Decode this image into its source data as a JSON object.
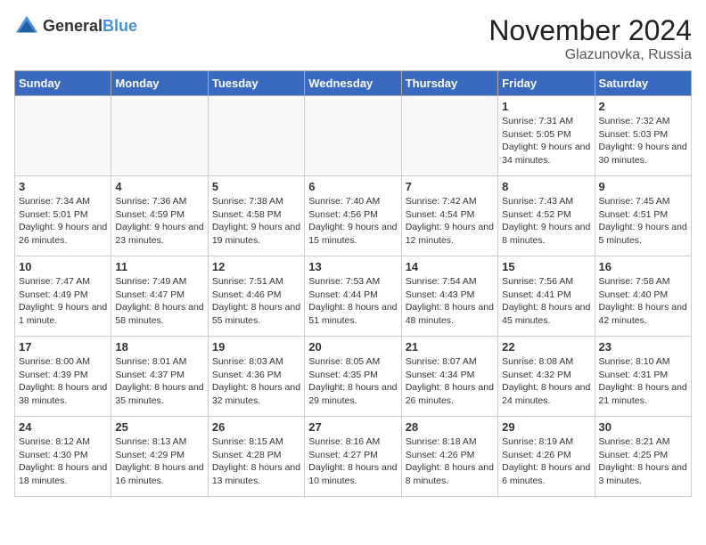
{
  "header": {
    "logo_general": "General",
    "logo_blue": "Blue",
    "month": "November 2024",
    "location": "Glazunovka, Russia"
  },
  "weekdays": [
    "Sunday",
    "Monday",
    "Tuesday",
    "Wednesday",
    "Thursday",
    "Friday",
    "Saturday"
  ],
  "weeks": [
    [
      {
        "day": "",
        "info": ""
      },
      {
        "day": "",
        "info": ""
      },
      {
        "day": "",
        "info": ""
      },
      {
        "day": "",
        "info": ""
      },
      {
        "day": "",
        "info": ""
      },
      {
        "day": "1",
        "info": "Sunrise: 7:31 AM\nSunset: 5:05 PM\nDaylight: 9 hours\nand 34 minutes."
      },
      {
        "day": "2",
        "info": "Sunrise: 7:32 AM\nSunset: 5:03 PM\nDaylight: 9 hours\nand 30 minutes."
      }
    ],
    [
      {
        "day": "3",
        "info": "Sunrise: 7:34 AM\nSunset: 5:01 PM\nDaylight: 9 hours\nand 26 minutes."
      },
      {
        "day": "4",
        "info": "Sunrise: 7:36 AM\nSunset: 4:59 PM\nDaylight: 9 hours\nand 23 minutes."
      },
      {
        "day": "5",
        "info": "Sunrise: 7:38 AM\nSunset: 4:58 PM\nDaylight: 9 hours\nand 19 minutes."
      },
      {
        "day": "6",
        "info": "Sunrise: 7:40 AM\nSunset: 4:56 PM\nDaylight: 9 hours\nand 15 minutes."
      },
      {
        "day": "7",
        "info": "Sunrise: 7:42 AM\nSunset: 4:54 PM\nDaylight: 9 hours\nand 12 minutes."
      },
      {
        "day": "8",
        "info": "Sunrise: 7:43 AM\nSunset: 4:52 PM\nDaylight: 9 hours\nand 8 minutes."
      },
      {
        "day": "9",
        "info": "Sunrise: 7:45 AM\nSunset: 4:51 PM\nDaylight: 9 hours\nand 5 minutes."
      }
    ],
    [
      {
        "day": "10",
        "info": "Sunrise: 7:47 AM\nSunset: 4:49 PM\nDaylight: 9 hours\nand 1 minute."
      },
      {
        "day": "11",
        "info": "Sunrise: 7:49 AM\nSunset: 4:47 PM\nDaylight: 8 hours\nand 58 minutes."
      },
      {
        "day": "12",
        "info": "Sunrise: 7:51 AM\nSunset: 4:46 PM\nDaylight: 8 hours\nand 55 minutes."
      },
      {
        "day": "13",
        "info": "Sunrise: 7:53 AM\nSunset: 4:44 PM\nDaylight: 8 hours\nand 51 minutes."
      },
      {
        "day": "14",
        "info": "Sunrise: 7:54 AM\nSunset: 4:43 PM\nDaylight: 8 hours\nand 48 minutes."
      },
      {
        "day": "15",
        "info": "Sunrise: 7:56 AM\nSunset: 4:41 PM\nDaylight: 8 hours\nand 45 minutes."
      },
      {
        "day": "16",
        "info": "Sunrise: 7:58 AM\nSunset: 4:40 PM\nDaylight: 8 hours\nand 42 minutes."
      }
    ],
    [
      {
        "day": "17",
        "info": "Sunrise: 8:00 AM\nSunset: 4:39 PM\nDaylight: 8 hours\nand 38 minutes."
      },
      {
        "day": "18",
        "info": "Sunrise: 8:01 AM\nSunset: 4:37 PM\nDaylight: 8 hours\nand 35 minutes."
      },
      {
        "day": "19",
        "info": "Sunrise: 8:03 AM\nSunset: 4:36 PM\nDaylight: 8 hours\nand 32 minutes."
      },
      {
        "day": "20",
        "info": "Sunrise: 8:05 AM\nSunset: 4:35 PM\nDaylight: 8 hours\nand 29 minutes."
      },
      {
        "day": "21",
        "info": "Sunrise: 8:07 AM\nSunset: 4:34 PM\nDaylight: 8 hours\nand 26 minutes."
      },
      {
        "day": "22",
        "info": "Sunrise: 8:08 AM\nSunset: 4:32 PM\nDaylight: 8 hours\nand 24 minutes."
      },
      {
        "day": "23",
        "info": "Sunrise: 8:10 AM\nSunset: 4:31 PM\nDaylight: 8 hours\nand 21 minutes."
      }
    ],
    [
      {
        "day": "24",
        "info": "Sunrise: 8:12 AM\nSunset: 4:30 PM\nDaylight: 8 hours\nand 18 minutes."
      },
      {
        "day": "25",
        "info": "Sunrise: 8:13 AM\nSunset: 4:29 PM\nDaylight: 8 hours\nand 16 minutes."
      },
      {
        "day": "26",
        "info": "Sunrise: 8:15 AM\nSunset: 4:28 PM\nDaylight: 8 hours\nand 13 minutes."
      },
      {
        "day": "27",
        "info": "Sunrise: 8:16 AM\nSunset: 4:27 PM\nDaylight: 8 hours\nand 10 minutes."
      },
      {
        "day": "28",
        "info": "Sunrise: 8:18 AM\nSunset: 4:26 PM\nDaylight: 8 hours\nand 8 minutes."
      },
      {
        "day": "29",
        "info": "Sunrise: 8:19 AM\nSunset: 4:26 PM\nDaylight: 8 hours\nand 6 minutes."
      },
      {
        "day": "30",
        "info": "Sunrise: 8:21 AM\nSunset: 4:25 PM\nDaylight: 8 hours\nand 3 minutes."
      }
    ]
  ]
}
